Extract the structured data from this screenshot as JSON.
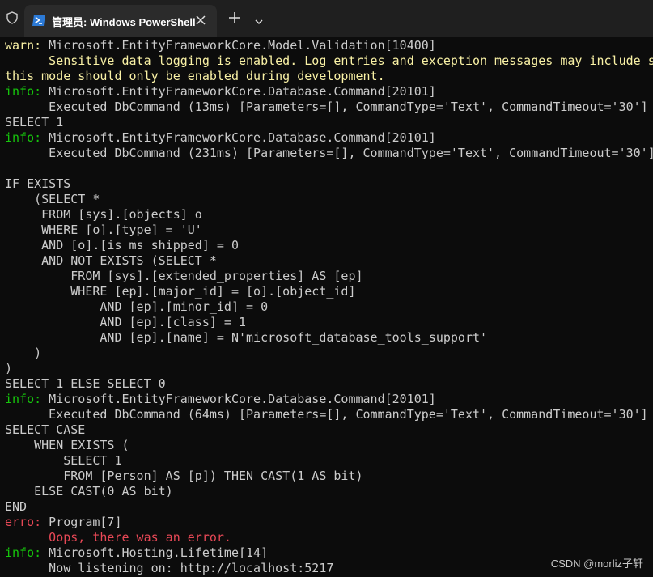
{
  "window": {
    "tab_title": "管理员: Windows PowerShell"
  },
  "icons": {
    "shield": "shield-icon",
    "powershell": "powershell-icon",
    "close": "close-icon",
    "new_tab": "plus-icon",
    "dropdown": "chevron-down-icon"
  },
  "colors": {
    "background": "#0c0c0c",
    "text": "#cccccc",
    "warn": "#f9f1a5",
    "info": "#16c60c",
    "error": "#e74856"
  },
  "lines": [
    {
      "level": "warn:",
      "text": " Microsoft.EntityFrameworkCore.Model.Validation[10400]"
    },
    {
      "level": "",
      "text": "      Sensitive data logging is enabled. Log entries and exception messages may include s",
      "style": "warn"
    },
    {
      "level": "",
      "text": "this mode should only be enabled during development.",
      "style": "warn"
    },
    {
      "level": "info:",
      "text": " Microsoft.EntityFrameworkCore.Database.Command[20101]"
    },
    {
      "level": "",
      "text": "      Executed DbCommand (13ms) [Parameters=[], CommandType='Text', CommandTimeout='30']"
    },
    {
      "level": "",
      "text": "SELECT 1"
    },
    {
      "level": "info:",
      "text": " Microsoft.EntityFrameworkCore.Database.Command[20101]"
    },
    {
      "level": "",
      "text": "      Executed DbCommand (231ms) [Parameters=[], CommandType='Text', CommandTimeout='30']"
    },
    {
      "level": "",
      "text": ""
    },
    {
      "level": "",
      "text": "IF EXISTS"
    },
    {
      "level": "",
      "text": "    (SELECT *"
    },
    {
      "level": "",
      "text": "     FROM [sys].[objects] o"
    },
    {
      "level": "",
      "text": "     WHERE [o].[type] = 'U'"
    },
    {
      "level": "",
      "text": "     AND [o].[is_ms_shipped] = 0"
    },
    {
      "level": "",
      "text": "     AND NOT EXISTS (SELECT *"
    },
    {
      "level": "",
      "text": "         FROM [sys].[extended_properties] AS [ep]"
    },
    {
      "level": "",
      "text": "         WHERE [ep].[major_id] = [o].[object_id]"
    },
    {
      "level": "",
      "text": "             AND [ep].[minor_id] = 0"
    },
    {
      "level": "",
      "text": "             AND [ep].[class] = 1"
    },
    {
      "level": "",
      "text": "             AND [ep].[name] = N'microsoft_database_tools_support'"
    },
    {
      "level": "",
      "text": "    )"
    },
    {
      "level": "",
      "text": ")"
    },
    {
      "level": "",
      "text": "SELECT 1 ELSE SELECT 0"
    },
    {
      "level": "info:",
      "text": " Microsoft.EntityFrameworkCore.Database.Command[20101]"
    },
    {
      "level": "",
      "text": "      Executed DbCommand (64ms) [Parameters=[], CommandType='Text', CommandTimeout='30']"
    },
    {
      "level": "",
      "text": "SELECT CASE"
    },
    {
      "level": "",
      "text": "    WHEN EXISTS ("
    },
    {
      "level": "",
      "text": "        SELECT 1"
    },
    {
      "level": "",
      "text": "        FROM [Person] AS [p]) THEN CAST(1 AS bit)"
    },
    {
      "level": "",
      "text": "    ELSE CAST(0 AS bit)"
    },
    {
      "level": "",
      "text": "END"
    },
    {
      "level": "erro:",
      "text": " Program[7]"
    },
    {
      "level": "",
      "text": "      Oops, there was an error.",
      "style": "err"
    },
    {
      "level": "info:",
      "text": " Microsoft.Hosting.Lifetime[14]"
    },
    {
      "level": "",
      "text": "      Now listening on: http://localhost:5217"
    }
  ],
  "watermark": "CSDN @morliz子轩"
}
